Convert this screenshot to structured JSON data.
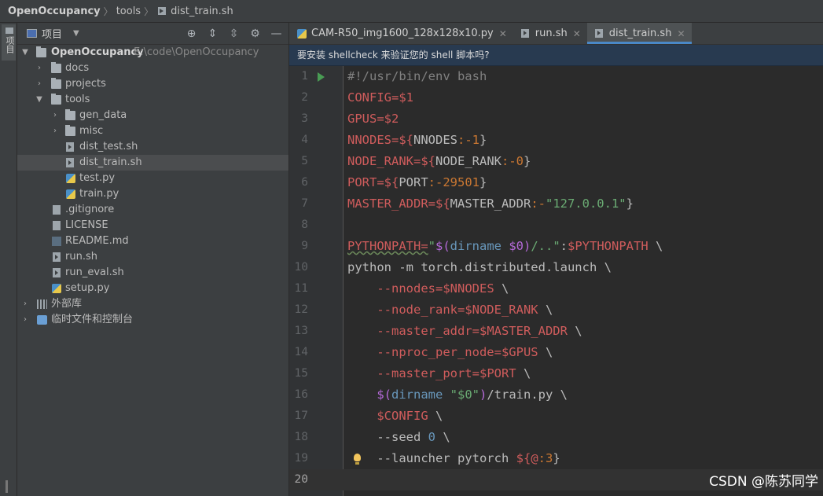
{
  "breadcrumb": {
    "project": "OpenOccupancy",
    "folder": "tools",
    "file": "dist_train.sh"
  },
  "side_strip": {
    "project_tab_label": "项目"
  },
  "project_panel": {
    "title": "项目",
    "tree": [
      {
        "label": "OpenOccupancy",
        "path": "E:\\code\\OpenOccupancy"
      },
      {
        "label": "docs"
      },
      {
        "label": "projects"
      },
      {
        "label": "tools"
      },
      {
        "label": "gen_data"
      },
      {
        "label": "misc"
      },
      {
        "label": "dist_test.sh"
      },
      {
        "label": "dist_train.sh"
      },
      {
        "label": "test.py"
      },
      {
        "label": "train.py"
      },
      {
        "label": ".gitignore"
      },
      {
        "label": "LICENSE"
      },
      {
        "label": "README.md"
      },
      {
        "label": "run.sh"
      },
      {
        "label": "run_eval.sh"
      },
      {
        "label": "setup.py"
      },
      {
        "label": "外部库"
      },
      {
        "label": "临时文件和控制台"
      }
    ]
  },
  "editor_tabs": [
    {
      "label": "CAM-R50_img1600_128x128x10.py"
    },
    {
      "label": "run.sh"
    },
    {
      "label": "dist_train.sh"
    }
  ],
  "banner": "要安装 shellcheck 来验证您的 shell 脚本吗?",
  "line_numbers": [
    "1",
    "2",
    "3",
    "4",
    "5",
    "6",
    "7",
    "8",
    "9",
    "10",
    "11",
    "12",
    "13",
    "14",
    "15",
    "16",
    "17",
    "18",
    "19",
    "20"
  ],
  "code": {
    "l1": "#!/usr/bin/env bash",
    "l2a": "CONFIG=",
    "l2b": "$1",
    "l3a": "GPUS=",
    "l3b": "$2",
    "l4a": "NNODES=",
    "l4b": "${",
    "l4c": "NNODES",
    "l4d": ":-1",
    "l4e": "}",
    "l5a": "NODE_RANK=",
    "l5b": "${",
    "l5c": "NODE_RANK",
    "l5d": ":-0",
    "l5e": "}",
    "l6a": "PORT=",
    "l6b": "${",
    "l6c": "PORT",
    "l6d": ":-29501",
    "l6e": "}",
    "l7a": "MASTER_ADDR=",
    "l7b": "${",
    "l7c": "MASTER_ADDR",
    "l7d": ":-",
    "l7e": "\"127.0.0.1\"",
    "l7f": "}",
    "l9a": "PYTHONPATH=",
    "l9b": "\"",
    "l9c": "$(",
    "l9d": "dirname ",
    "l9e": "$0",
    "l9f": ")",
    "l9g": "/..\"",
    "l9h": ":",
    "l9i": "$PYTHONPATH",
    "l9j": " \\",
    "l10": "python -m torch.distributed.launch \\",
    "l11a": "    --nnodes=",
    "l11b": "$NNODES",
    "l11c": " \\",
    "l12a": "    --node_rank=",
    "l12b": "$NODE_RANK",
    "l12c": " \\",
    "l13a": "    --master_addr=",
    "l13b": "$MASTER_ADDR",
    "l13c": " \\",
    "l14a": "    --nproc_per_node=",
    "l14b": "$GPUS",
    "l14c": " \\",
    "l15a": "    --master_port=",
    "l15b": "$PORT",
    "l15c": " \\",
    "l16a": "    ",
    "l16b": "$(",
    "l16c": "dirname ",
    "l16d": "\"$0\"",
    "l16e": ")",
    "l16f": "/train.py \\",
    "l17a": "    ",
    "l17b": "$CONFIG",
    "l17c": " \\",
    "l18a": "    --seed ",
    "l18b": "0",
    "l18c": " \\",
    "l19a": "    --launcher pytorch ",
    "l19b": "${",
    "l19c": "@",
    "l19d": ":3",
    "l19e": "}"
  },
  "watermark": "CSDN @陈苏同学",
  "colors": {
    "accent": "#4a88c7",
    "keyword_var": "#cf5c5c",
    "string": "#6a8759",
    "number": "#6897bb",
    "run_icon": "#499c54"
  }
}
